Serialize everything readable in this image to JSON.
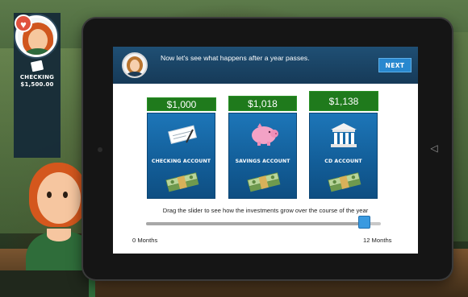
{
  "player": {
    "account_label": "CHECKING",
    "balance": "$1,500.00"
  },
  "header": {
    "message": "Now let's see what happens after a year passes.",
    "next_label": "NEXT"
  },
  "accounts": [
    {
      "amount": "$1,000",
      "label": "CHECKING ACCOUNT",
      "icon": "check-icon"
    },
    {
      "amount": "$1,018",
      "label": "SAVINGS ACCOUNT",
      "icon": "piggy-bank-icon"
    },
    {
      "amount": "$1,138",
      "label": "CD ACCOUNT",
      "icon": "bank-building-icon"
    }
  ],
  "slider": {
    "caption": "Drag the slider to see how the investments grow over the course of the year",
    "start_label": "0 Months",
    "end_label": "12 Months",
    "value_fraction": 0.93
  },
  "colors": {
    "header_bg": "#1f4f74",
    "card_bg": "#1d76b8",
    "amount_bg": "#1f7a1c",
    "next_button": "#2888cf",
    "slider_thumb": "#3a9ae0"
  }
}
